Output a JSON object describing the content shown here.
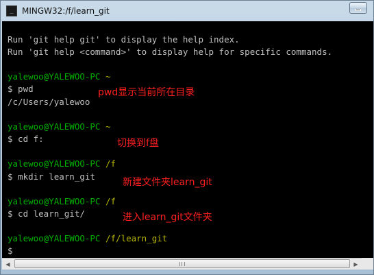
{
  "window": {
    "title": "MINGW32:/f/learn_git",
    "app_icon_glyph": "_"
  },
  "terminal": {
    "help_lines": [
      "Run 'git help git' to display the help index.",
      "Run 'git help <command>' to display help for specific commands."
    ],
    "blocks": [
      {
        "user": "yalewoo@YALEWOO-PC",
        "path": "~",
        "command": "$ pwd",
        "output": "/c/Users/yalewoo",
        "note": "pwd显示当前所在目录"
      },
      {
        "user": "yalewoo@YALEWOO-PC",
        "path": "~",
        "command": "$ cd f:",
        "note": "切换到f盘"
      },
      {
        "user": "yalewoo@YALEWOO-PC",
        "path": "/f",
        "command": "$ mkdir learn_git",
        "note": "新建文件夹learn_git"
      },
      {
        "user": "yalewoo@YALEWOO-PC",
        "path": "/f",
        "command": "$ cd learn_git/",
        "note": "进入learn_git文件夹"
      },
      {
        "user": "yalewoo@YALEWOO-PC",
        "path": "/f/learn_git",
        "command": "$"
      }
    ]
  },
  "scrollbar": {
    "left_arrow": "◀",
    "right_arrow": "▶"
  },
  "colors": {
    "prompt_user": "#00b000",
    "prompt_path": "#b6b600",
    "text": "#c0c0c0",
    "annotation": "#ff2020",
    "background": "#000000"
  }
}
